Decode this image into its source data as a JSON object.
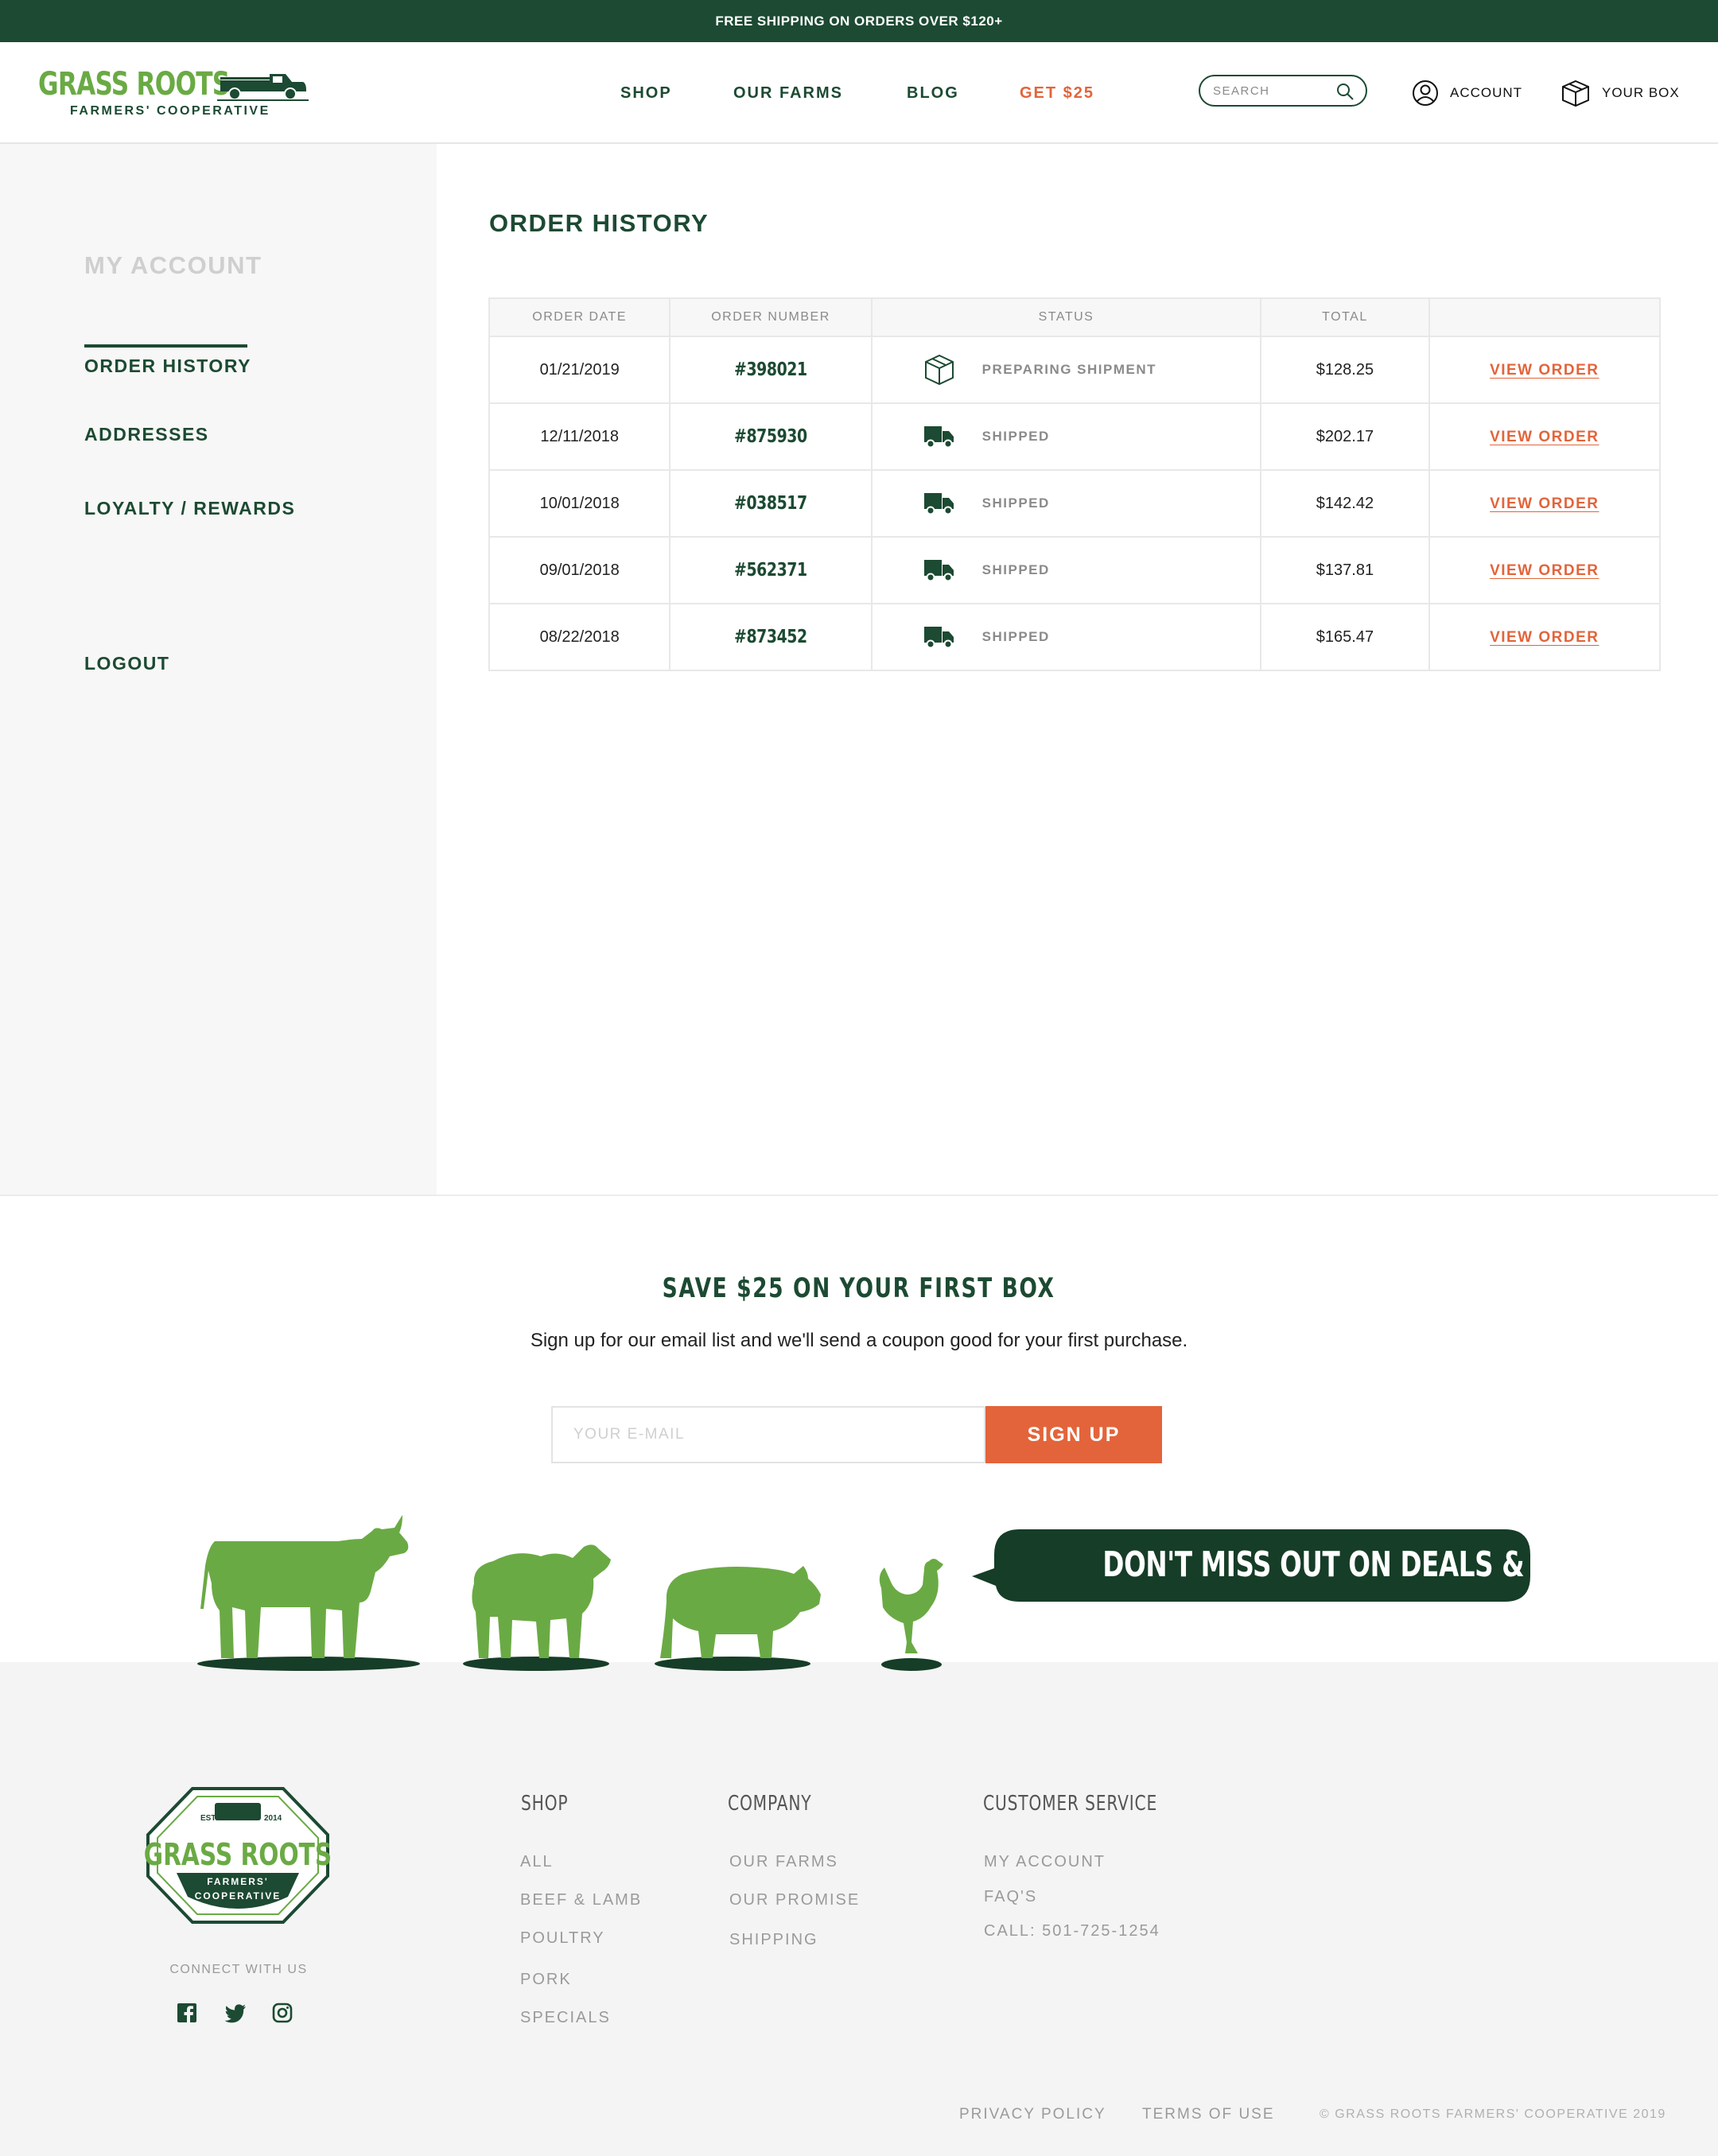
{
  "promo": {
    "text": "FREE SHIPPING ON ORDERS OVER $120+"
  },
  "brand": {
    "name": "GRASS ROOTS",
    "tagline": "FARMERS' COOPERATIVE"
  },
  "nav": {
    "shop": "SHOP",
    "farms": "OUR FARMS",
    "blog": "BLOG",
    "get": "GET $25"
  },
  "search": {
    "placeholder": "SEARCH",
    "value": ""
  },
  "header": {
    "account": "ACCOUNT",
    "box": "YOUR BOX"
  },
  "sidebar": {
    "title": "MY ACCOUNT",
    "items": [
      {
        "label": "ORDER HISTORY",
        "active": true
      },
      {
        "label": "ADDRESSES",
        "active": false
      },
      {
        "label": "LOYALTY / REWARDS",
        "active": false
      }
    ],
    "logout": "LOGOUT"
  },
  "orders": {
    "title": "ORDER HISTORY",
    "columns": [
      "ORDER DATE",
      "ORDER NUMBER",
      "STATUS",
      "TOTAL",
      ""
    ],
    "rows": [
      {
        "date": "01/21/2019",
        "number": "#398021",
        "status": "PREPARING SHIPMENT",
        "status_icon": "package-icon",
        "total": "$128.25",
        "action": "VIEW ORDER"
      },
      {
        "date": "12/11/2018",
        "number": "#875930",
        "status": "SHIPPED",
        "status_icon": "truck-icon",
        "total": "$202.17",
        "action": "VIEW ORDER"
      },
      {
        "date": "10/01/2018",
        "number": "#038517",
        "status": "SHIPPED",
        "status_icon": "truck-icon",
        "total": "$142.42",
        "action": "VIEW ORDER"
      },
      {
        "date": "09/01/2018",
        "number": "#562371",
        "status": "SHIPPED",
        "status_icon": "truck-icon",
        "total": "$137.81",
        "action": "VIEW ORDER"
      },
      {
        "date": "08/22/2018",
        "number": "#873452",
        "status": "SHIPPED",
        "status_icon": "truck-icon",
        "total": "$165.47",
        "action": "VIEW ORDER"
      }
    ]
  },
  "signup": {
    "title": "SAVE $25 ON YOUR FIRST BOX",
    "subtitle": "Sign up for our email list and we'll send a coupon good for your first purchase.",
    "placeholder": "YOUR E-MAIL",
    "button": "SIGN UP",
    "bubble": "DON'T MISS OUT ON DEALS & NEWS!"
  },
  "footer": {
    "badge": {
      "estd": "ESTD.",
      "year": "2014",
      "name": "GRASS ROOTS",
      "line1": "FARMERS'",
      "line2": "COOPERATIVE"
    },
    "connect": "CONNECT WITH US",
    "shop": {
      "heading": "SHOP",
      "links": [
        "ALL",
        "BEEF & LAMB",
        "POULTRY",
        "PORK",
        "SPECIALS"
      ]
    },
    "company": {
      "heading": "COMPANY",
      "links": [
        "OUR FARMS",
        "OUR PROMISE",
        "SHIPPING"
      ]
    },
    "service": {
      "heading": "CUSTOMER SERVICE",
      "links": [
        "MY ACCOUNT",
        "FAQ'S",
        "CALL: 501-725-1254"
      ]
    },
    "privacy": "PRIVACY POLICY",
    "terms": "TERMS OF USE",
    "copyright": "© GRASS ROOTS FARMERS' COOPERATIVE 2019"
  },
  "colors": {
    "brand_dark": "#1c4a32",
    "brand_green": "#6aaa44",
    "accent": "#e3643a"
  }
}
